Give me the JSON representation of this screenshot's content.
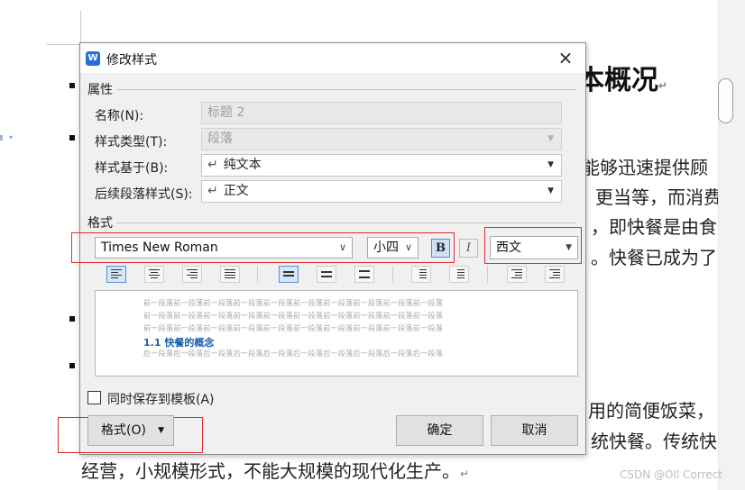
{
  "document": {
    "heading_fragment": "本概况",
    "lines": [
      "能够迅速提供顾",
      "更当等，而消费",
      "，即快餐是由食",
      "。快餐已成为了",
      "用的简便饭菜，",
      "统快餐。传统快",
      "经营，小规模形式，不能大规模的现代化生产。"
    ],
    "paragraph_mark": "↵",
    "watermark": "CSDN @OIl Correct"
  },
  "dialog": {
    "title": "修改样式",
    "app_icon_letter": "W",
    "close_label": "×",
    "properties": {
      "section_label": "属性",
      "name_label": "名称(N):",
      "name_value": "标题 2",
      "style_type_label": "样式类型(T):",
      "style_type_value": "段落",
      "based_on_label": "样式基于(B):",
      "based_on_value": "纯文本",
      "following_label": "后续段落样式(S):",
      "following_value": "正文",
      "return_glyph": "↵"
    },
    "format": {
      "section_label": "格式",
      "font_name": "Times New Roman",
      "font_size": "小四",
      "bold_label": "B",
      "italic_label": "I",
      "script_value": "西文",
      "bold_active": true
    },
    "preview": {
      "prev_paragraph_line": "前一段落前一段落前一段落前一段落前一段落前一段落前一段落前一段落前一段落前一段落",
      "sample_heading": "1.1 快餐的概念",
      "next_paragraph_line": "后一段落后一段落后一段落后一段落后一段落后一段落后一段落后一段落后一段落后一段落"
    },
    "save_to_template_label": "同时保存到模板(A)",
    "save_to_template_checked": false,
    "format_button_label": "格式(O)",
    "ok_label": "确定",
    "cancel_label": "取消"
  },
  "colors": {
    "accent": "#2b6fd6",
    "highlight_box": "#e02b2b",
    "preview_heading": "#1a5fb0"
  }
}
